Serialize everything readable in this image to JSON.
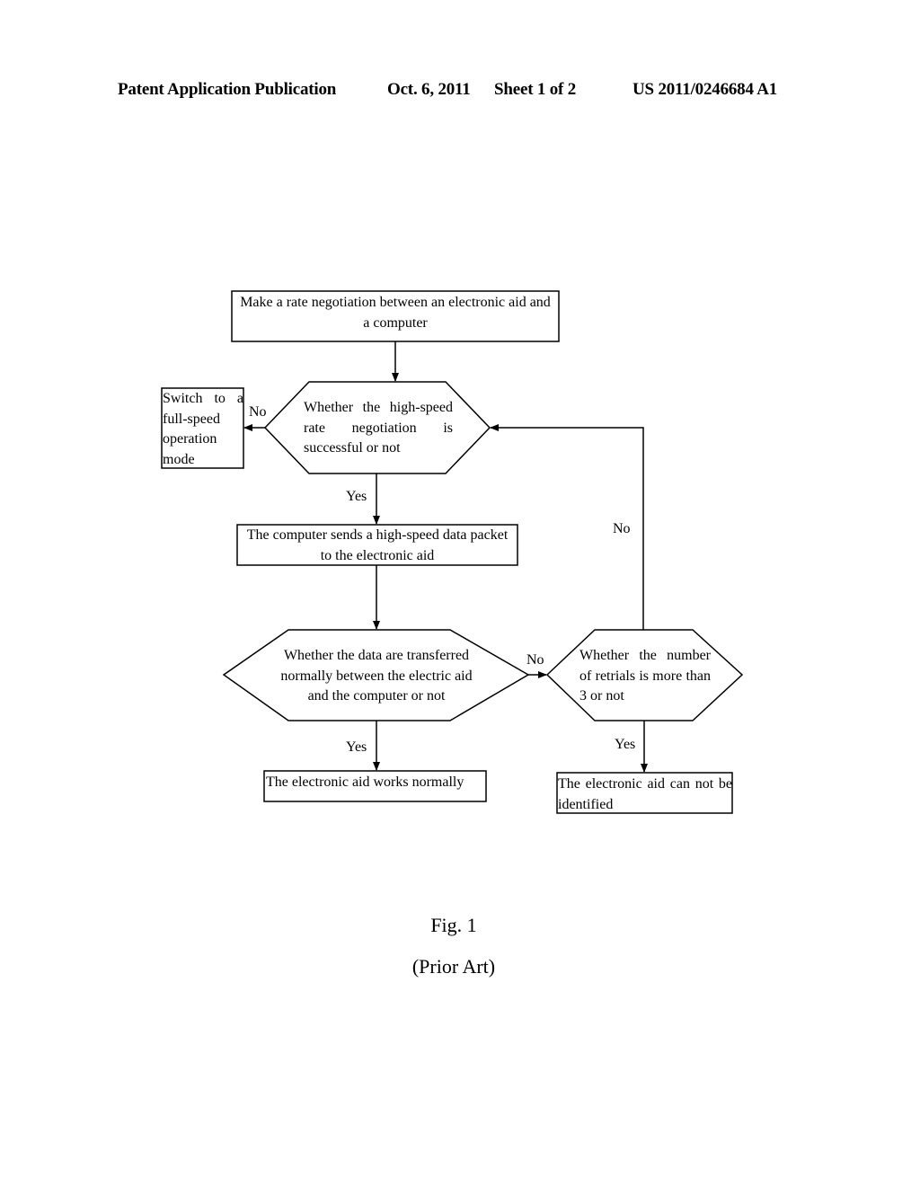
{
  "header": {
    "publication": "Patent Application Publication",
    "date": "Oct. 6, 2011",
    "sheet": "Sheet 1 of 2",
    "number": "US 2011/0246684 A1"
  },
  "flowchart": {
    "nodes": {
      "start": "Make a rate negotiation between an electronic aid and a computer",
      "decision_highspeed": "Whether the high-speed rate negotiation is successful or not",
      "fullspeed": "Switch to a full-speed operation mode",
      "send_packet": "The computer sends a high-speed data packet to the electronic aid",
      "decision_transfer": "Whether the data are transferred normally between the electric aid and the computer or not",
      "decision_retrials": "Whether the number of retrials is more than 3 or not",
      "works_normally": "The electronic aid works normally",
      "not_identified": "The electronic aid can not be identified"
    },
    "edge_labels": {
      "highspeed_no": "No",
      "highspeed_yes": "Yes",
      "transfer_no": "No",
      "transfer_yes": "Yes",
      "retrials_no": "No",
      "retrials_yes": "Yes"
    }
  },
  "caption": {
    "figure": "Fig. 1",
    "note": "(Prior Art)"
  }
}
